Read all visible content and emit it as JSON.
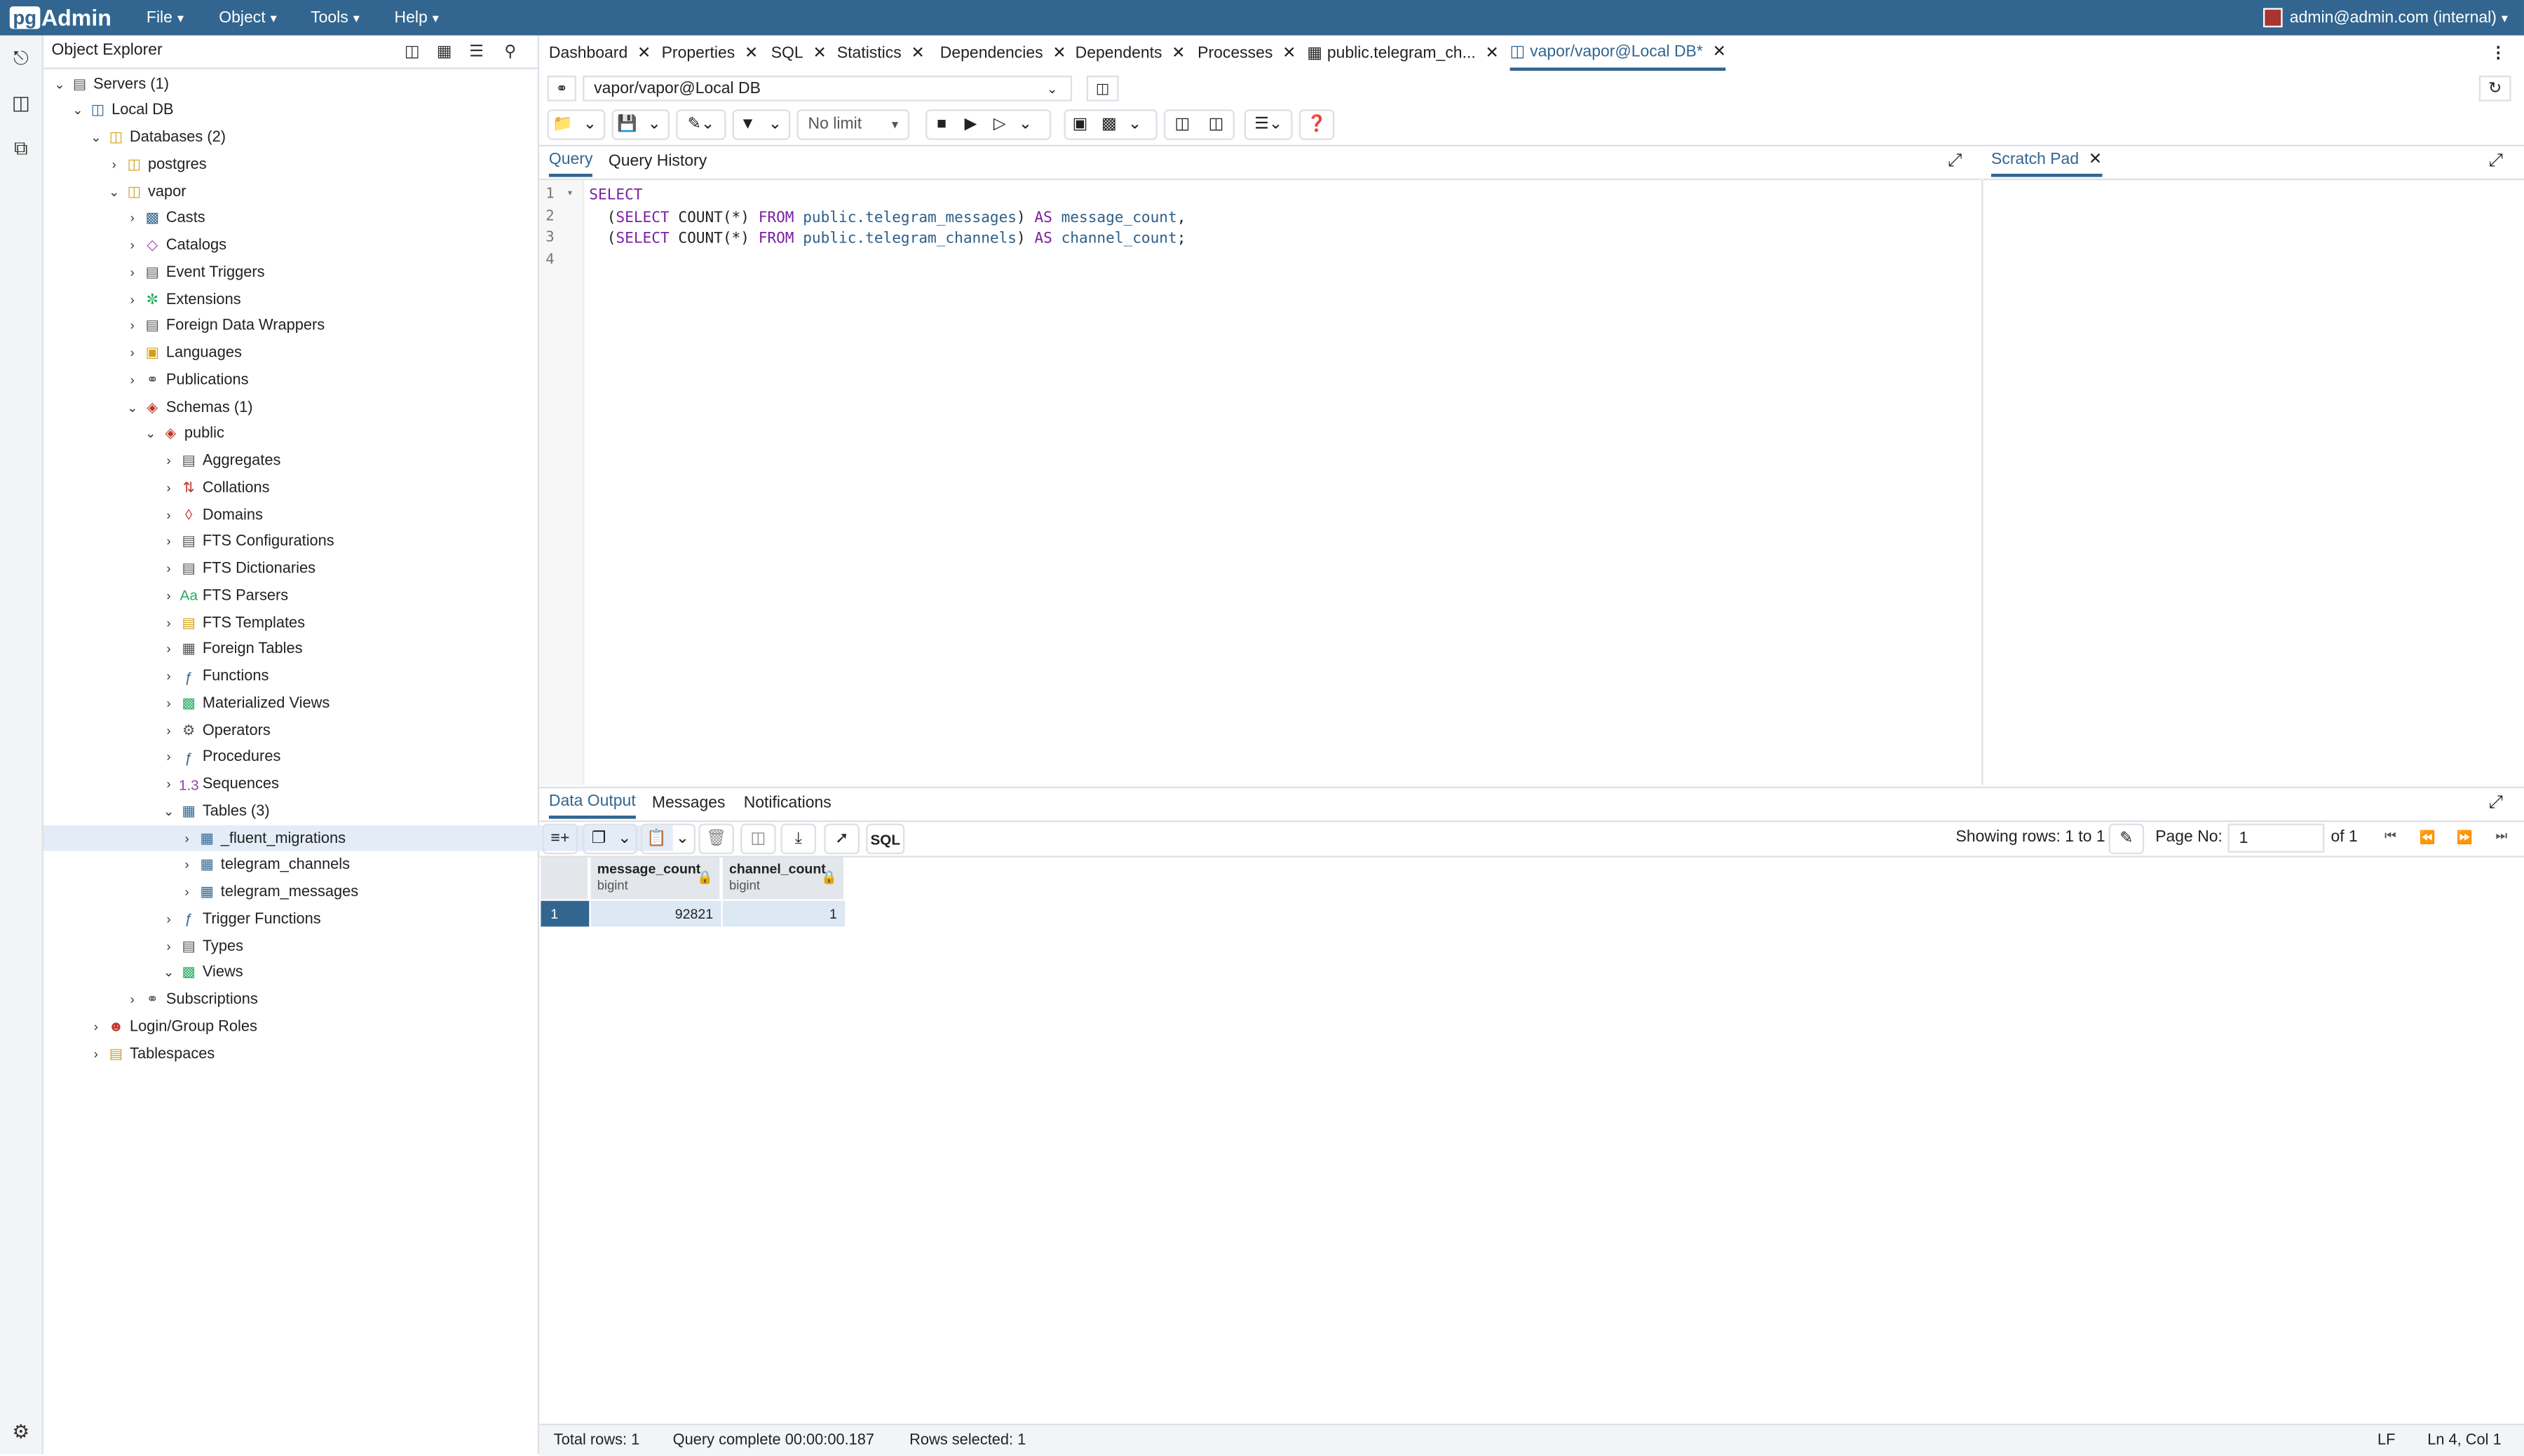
{
  "app": {
    "logo_prefix": "pg",
    "logo_suffix": "Admin"
  },
  "menu": {
    "file": "File",
    "object": "Object",
    "tools": "Tools",
    "help": "Help"
  },
  "user": "admin@admin.com (internal)",
  "object_explorer": {
    "title": "Object Explorer",
    "tree": [
      {
        "label": "Servers (1)",
        "depth": 0,
        "tw": "open",
        "icon": "servers-icon"
      },
      {
        "label": "Local DB",
        "depth": 1,
        "tw": "open",
        "icon": "server-icon"
      },
      {
        "label": "Databases (2)",
        "depth": 2,
        "tw": "open",
        "icon": "databases-icon"
      },
      {
        "label": "postgres",
        "depth": 3,
        "tw": "closed",
        "icon": "database-icon"
      },
      {
        "label": "vapor",
        "depth": 3,
        "tw": "open",
        "icon": "database-icon"
      },
      {
        "label": "Casts",
        "depth": 4,
        "tw": "closed",
        "icon": "casts-icon"
      },
      {
        "label": "Catalogs",
        "depth": 4,
        "tw": "closed",
        "icon": "catalogs-icon"
      },
      {
        "label": "Event Triggers",
        "depth": 4,
        "tw": "closed",
        "icon": "event-triggers-icon"
      },
      {
        "label": "Extensions",
        "depth": 4,
        "tw": "closed",
        "icon": "extensions-icon"
      },
      {
        "label": "Foreign Data Wrappers",
        "depth": 4,
        "tw": "closed",
        "icon": "fdw-icon"
      },
      {
        "label": "Languages",
        "depth": 4,
        "tw": "closed",
        "icon": "languages-icon"
      },
      {
        "label": "Publications",
        "depth": 4,
        "tw": "closed",
        "icon": "publications-icon"
      },
      {
        "label": "Schemas (1)",
        "depth": 4,
        "tw": "open",
        "icon": "schemas-icon"
      },
      {
        "label": "public",
        "depth": 5,
        "tw": "open",
        "icon": "schema-icon"
      },
      {
        "label": "Aggregates",
        "depth": 6,
        "tw": "closed",
        "icon": "aggregates-icon"
      },
      {
        "label": "Collations",
        "depth": 6,
        "tw": "closed",
        "icon": "collations-icon"
      },
      {
        "label": "Domains",
        "depth": 6,
        "tw": "closed",
        "icon": "domains-icon"
      },
      {
        "label": "FTS Configurations",
        "depth": 6,
        "tw": "closed",
        "icon": "fts-config-icon"
      },
      {
        "label": "FTS Dictionaries",
        "depth": 6,
        "tw": "closed",
        "icon": "fts-dict-icon"
      },
      {
        "label": "FTS Parsers",
        "depth": 6,
        "tw": "closed",
        "icon": "fts-parser-icon"
      },
      {
        "label": "FTS Templates",
        "depth": 6,
        "tw": "closed",
        "icon": "fts-template-icon"
      },
      {
        "label": "Foreign Tables",
        "depth": 6,
        "tw": "closed",
        "icon": "foreign-tables-icon"
      },
      {
        "label": "Functions",
        "depth": 6,
        "tw": "closed",
        "icon": "functions-icon"
      },
      {
        "label": "Materialized Views",
        "depth": 6,
        "tw": "closed",
        "icon": "mat-views-icon"
      },
      {
        "label": "Operators",
        "depth": 6,
        "tw": "closed",
        "icon": "operators-icon"
      },
      {
        "label": "Procedures",
        "depth": 6,
        "tw": "closed",
        "icon": "procedures-icon"
      },
      {
        "label": "Sequences",
        "depth": 6,
        "tw": "closed",
        "icon": "sequences-icon"
      },
      {
        "label": "Tables (3)",
        "depth": 6,
        "tw": "open",
        "icon": "tables-icon"
      },
      {
        "label": "_fluent_migrations",
        "depth": 7,
        "tw": "closed",
        "icon": "table-icon",
        "selected": true
      },
      {
        "label": "telegram_channels",
        "depth": 7,
        "tw": "closed",
        "icon": "table-icon"
      },
      {
        "label": "telegram_messages",
        "depth": 7,
        "tw": "closed",
        "icon": "table-icon"
      },
      {
        "label": "Trigger Functions",
        "depth": 6,
        "tw": "closed",
        "icon": "trigger-functions-icon"
      },
      {
        "label": "Types",
        "depth": 6,
        "tw": "closed",
        "icon": "types-icon"
      },
      {
        "label": "Views",
        "depth": 6,
        "tw": "open",
        "icon": "views-icon"
      },
      {
        "label": "Subscriptions",
        "depth": 4,
        "tw": "closed",
        "icon": "subscriptions-icon"
      },
      {
        "label": "Login/Group Roles",
        "depth": 2,
        "tw": "closed",
        "icon": "roles-icon"
      },
      {
        "label": "Tablespaces",
        "depth": 2,
        "tw": "closed",
        "icon": "tablespaces-icon"
      }
    ]
  },
  "tabs": [
    {
      "label": "Dashboard"
    },
    {
      "label": "Properties"
    },
    {
      "label": "SQL"
    },
    {
      "label": "Statistics"
    },
    {
      "label": "Dependencies"
    },
    {
      "label": "Dependents"
    },
    {
      "label": "Processes"
    },
    {
      "label": "public.telegram_ch..."
    },
    {
      "label": "vapor/vapor@Local DB*",
      "active": true
    }
  ],
  "connection": {
    "label": "vapor/vapor@Local DB"
  },
  "toolbar": {
    "limit": "No limit"
  },
  "query_tabs": {
    "query": "Query",
    "history": "Query History"
  },
  "scratch": {
    "label": "Scratch Pad"
  },
  "editor": {
    "line_numbers": [
      "1",
      "2",
      "3",
      "4"
    ],
    "line1_kw": "SELECT",
    "line2": {
      "open": "  (",
      "kw1": "SELECT",
      "fn": " COUNT(*) ",
      "kw2": "FROM",
      "table": " public.telegram_messages",
      "close": ") ",
      "kw3": "AS",
      "alias": " message_count",
      "end": ","
    },
    "line3": {
      "open": "  (",
      "kw1": "SELECT",
      "fn": " COUNT(*) ",
      "kw2": "FROM",
      "table": " public.telegram_channels",
      "close": ") ",
      "kw3": "AS",
      "alias": " channel_count",
      "end": ";"
    }
  },
  "results": {
    "tabs": {
      "data_output": "Data Output",
      "messages": "Messages",
      "notifications": "Notifications"
    },
    "showing": "Showing rows: 1 to 1",
    "page_no_label": "Page No:",
    "page_no_value": "1",
    "of": "of 1",
    "sql_btn": "SQL",
    "columns": [
      {
        "name": "message_count",
        "type": "bigint"
      },
      {
        "name": "channel_count",
        "type": "bigint"
      }
    ],
    "rows": [
      {
        "row_num": "1",
        "values": [
          "92821",
          "1"
        ]
      }
    ]
  },
  "status": {
    "total_rows": "Total rows: 1",
    "query_complete": "Query complete 00:00:00.187",
    "rows_selected": "Rows selected: 1",
    "eol": "LF",
    "cursor": "Ln 4, Col 1"
  },
  "colors": {
    "brand": "#326690",
    "selected_row": "#e3ecf7"
  }
}
